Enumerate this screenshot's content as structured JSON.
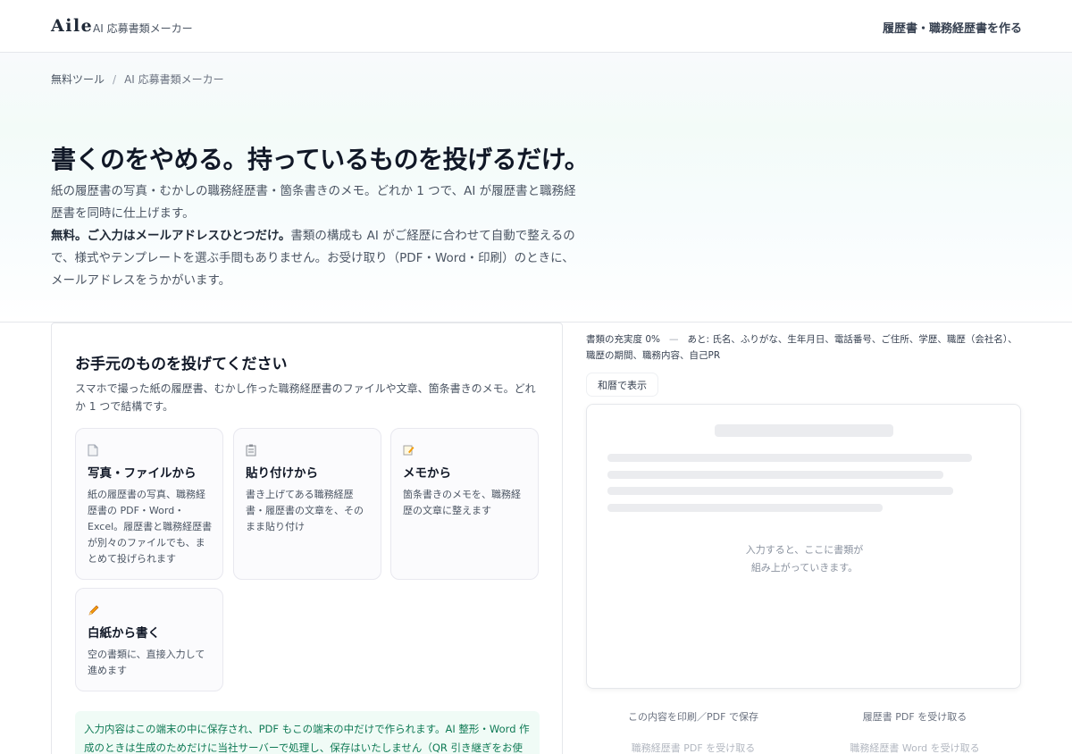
{
  "header": {
    "logo": "Aile",
    "product": "AI 応募書類メーカー",
    "cta": "履歴書・職務経歴書を作る"
  },
  "breadcrumb": {
    "root": "無料ツール",
    "separator": "/",
    "current": "AI 応募書類メーカー"
  },
  "hero": {
    "title": "書くのをやめる。持っているものを投げるだけ。",
    "lead": "紙の履歴書の写真・むかしの職務経歴書・箇条書きのメモ。どれか 1 つで、AI が履歴書と職務経歴書を同時に仕上げます。",
    "emphasis": "無料。ご入力はメールアドレスひとつだけ。",
    "detail": "書類の構成も AI がご経歴に合わせて自動で整えるので、様式やテンプレートを選ぶ手間もありません。お受け取り（PDF・Word・印刷）のときに、メールアドレスをうかがいます。"
  },
  "input_card": {
    "title": "お手元のものを投げてください",
    "description": "スマホで撮った紙の履歴書、むかし作った職務経歴書のファイルや文章、箇条書きのメモ。どれか 1 つで結構です。",
    "options": [
      {
        "icon": "document-icon",
        "title": "写真・ファイルから",
        "description": "紙の履歴書の写真、職務経歴書の PDF・Word・Excel。履歴書と職務経歴書が別々のファイルでも、まとめて投げられます"
      },
      {
        "icon": "clipboard-icon",
        "title": "貼り付けから",
        "description": "書き上げてある職務経歴書・履歴書の文章を、そのまま貼り付け"
      },
      {
        "icon": "memo-icon",
        "title": "メモから",
        "description": "箇条書きのメモを、職務経歴の文章に整えます"
      },
      {
        "icon": "pencil-icon",
        "title": "白紙から書く",
        "description": "空の書類に、直接入力して進めます"
      }
    ],
    "privacy_notice": "入力内容はこの端末の中に保存され、PDF もこの端末の中だけで作られます。AI 整形・Word 作成のときは生成のためだけに当社サーバーで処理し、保存はいたしません（QR 引き継ぎをお使いの場合のみ"
  },
  "preview_panel": {
    "completeness_label": "書類の充実度 0%",
    "separator": "—",
    "missing_label": "あと: 氏名、ふりがな、生年月日、電話番号、ご住所、学歴、職歴（会社名）、職歴の期間、職務内容、自己PR",
    "era_toggle": "和暦で表示",
    "placeholder_line1": "入力すると、ここに書類が",
    "placeholder_line2": "組み上がっていきます。",
    "print_button": "この内容を印刷／PDF で保存",
    "resume_pdf_button": "履歴書 PDF を受け取る",
    "cv_pdf_button": "職務経歴書 PDF を受け取る",
    "cv_word_button": "職務経歴書 Word を受け取る"
  },
  "colors": {
    "accent_green": "#0f7a55",
    "notice_bg": "#f0fbf6",
    "text_primary": "#111827",
    "text_secondary": "#4b5563"
  }
}
